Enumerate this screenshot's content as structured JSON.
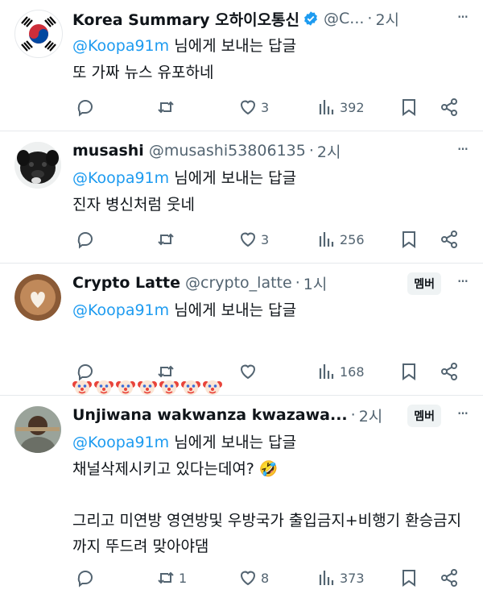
{
  "tweets": [
    {
      "name": "Korea Summary 오하이오통신",
      "handle": "@C...",
      "time": "2시",
      "verified": true,
      "badge": "",
      "reply_prefix": "",
      "mention": "@Koopa91m",
      "reply_suffix": " 님에게 보내는 답글",
      "body": "또 가짜 뉴스 유포하네",
      "replies": "",
      "retweets": "",
      "likes": "3",
      "views": "392",
      "avatar": "korean-flag-icon"
    },
    {
      "name": "musashi",
      "handle": "@musashi53806135",
      "time": "2시",
      "verified": false,
      "badge": "",
      "mention": "@Koopa91m",
      "reply_suffix": " 님에게 보내는 답글",
      "body": "진자 병신처럼 웃네",
      "replies": "",
      "retweets": "",
      "likes": "3",
      "views": "256",
      "avatar": "black-dog-avatar"
    },
    {
      "name": "Crypto Latte",
      "handle": "@crypto_latte",
      "time": "1시",
      "verified": false,
      "badge": "멤버",
      "mention": "@Koopa91m",
      "reply_suffix": " 님에게 보내는 답글",
      "body": "",
      "emoji_count": 7,
      "replies": "",
      "retweets": "",
      "likes": "",
      "views": "168",
      "avatar": "latte-art-avatar"
    },
    {
      "name": "Unjiwana wakwanza kwazawa...",
      "handle": "",
      "time": "2시",
      "verified": false,
      "badge": "멤버",
      "mention": "@Koopa91m",
      "reply_suffix": " 님에게 보내는 답글",
      "body": "채널삭제시키고 있다는데여? 🤣\n\n그리고 미연방 영연방및 우방국가 출입금지+비행기 환승금지까지 뚜드려 맞아야댐",
      "replies": "",
      "retweets": "1",
      "likes": "8",
      "views": "373",
      "avatar": "person-avatar"
    }
  ],
  "colors": {
    "accent": "#1d9bf0",
    "muted": "#536471",
    "text": "#0f1419",
    "badge_bg": "#eff3f4"
  }
}
